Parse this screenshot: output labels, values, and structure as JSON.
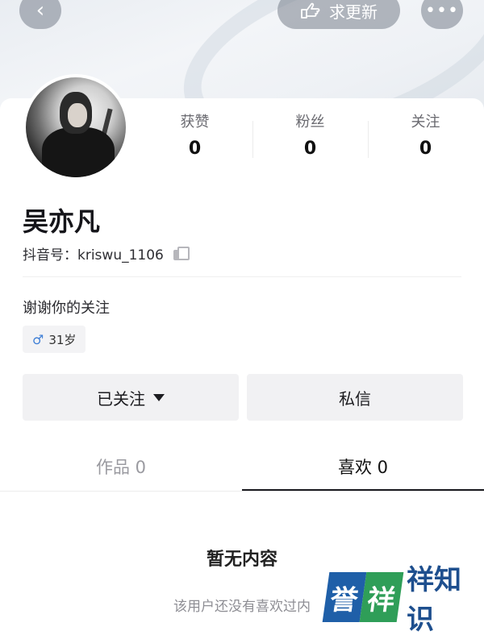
{
  "header": {
    "back_icon": "chevron-left-icon",
    "update_label": "求更新",
    "update_icon": "pointing-hand-icon",
    "more_label": "•••"
  },
  "stats": [
    {
      "label": "获赞",
      "value": "0"
    },
    {
      "label": "粉丝",
      "value": "0"
    },
    {
      "label": "关注",
      "value": "0"
    }
  ],
  "profile": {
    "name": "吴亦凡",
    "douyin_id": "抖音号：kriswu_1106",
    "bio": "谢谢你的关注",
    "gender_icon": "♂",
    "age_tag": "31岁"
  },
  "actions": {
    "followed_label": "已关注",
    "message_label": "私信"
  },
  "tabs": [
    {
      "label": "作品 0"
    },
    {
      "label": "喜欢 0"
    }
  ],
  "empty": {
    "title": "暂无内容",
    "description": "该用户还没有喜欢过内"
  },
  "watermark": {
    "part1": "誉",
    "part2": "祥",
    "part3": "祥知识"
  },
  "colors": {
    "accent_male": "#3f7fd6",
    "watermark_blue": "#1f5fa8",
    "watermark_green": "#2f9e58"
  }
}
